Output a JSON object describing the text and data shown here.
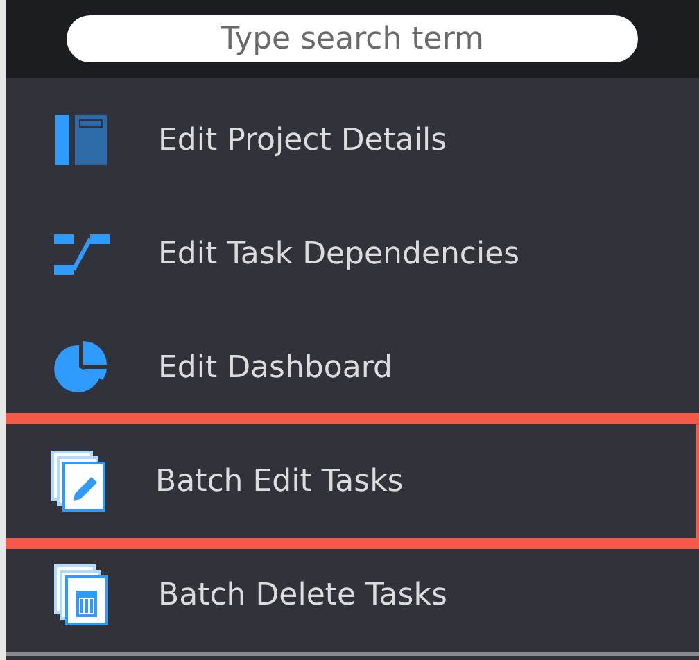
{
  "search": {
    "placeholder": "Type search term"
  },
  "menu_items": [
    {
      "kind": "project-details",
      "label": "Edit Project Details",
      "highlighted": false
    },
    {
      "kind": "dependencies",
      "label": "Edit Task Dependencies",
      "highlighted": false
    },
    {
      "kind": "dashboard",
      "label": "Edit Dashboard",
      "highlighted": false
    },
    {
      "kind": "batch-edit",
      "label": "Batch Edit Tasks",
      "highlighted": true
    },
    {
      "kind": "batch-delete",
      "label": "Batch Delete Tasks",
      "highlighted": false
    }
  ]
}
